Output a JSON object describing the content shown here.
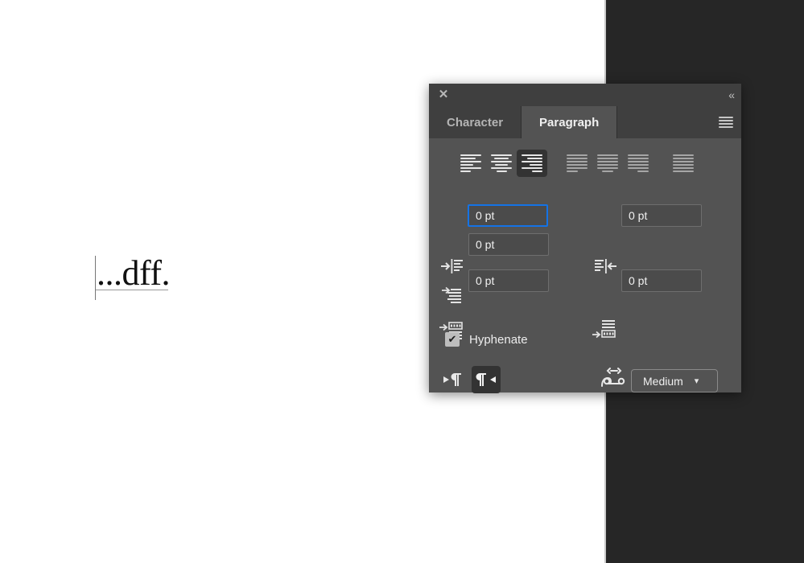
{
  "canvas": {
    "text_object": {
      "content": "...dff.",
      "caret_visible": true,
      "baseline_visible": true
    },
    "page_background": "#ffffff",
    "workspace_background": "#262626"
  },
  "panel": {
    "titlebar": {
      "close_label": "✕",
      "collapse_label": "«",
      "close_icon": "close-icon",
      "collapse_icon": "double-chevron-left-icon"
    },
    "tabs": [
      {
        "label": "Character",
        "active": false
      },
      {
        "label": "Paragraph",
        "active": true
      }
    ],
    "menu_icon": "hamburger-menu-icon",
    "alignment": {
      "group_label": "Paragraph alignment",
      "options": [
        {
          "name": "align-left",
          "label": "Align left",
          "selected": false,
          "enabled": true
        },
        {
          "name": "align-center",
          "label": "Align center",
          "selected": false,
          "enabled": true
        },
        {
          "name": "align-right",
          "label": "Align right",
          "selected": true,
          "enabled": true
        },
        {
          "name": "justify-last-left",
          "label": "Justify with last line aligned left",
          "selected": false,
          "enabled": false
        },
        {
          "name": "justify-last-center",
          "label": "Justify with last line aligned center",
          "selected": false,
          "enabled": false
        },
        {
          "name": "justify-last-right",
          "label": "Justify with last line aligned right",
          "selected": false,
          "enabled": false
        },
        {
          "name": "justify-all",
          "label": "Justify all lines",
          "selected": false,
          "enabled": false
        }
      ]
    },
    "fields": {
      "indent_left": {
        "icon": "indent-left-icon",
        "value": "0 pt",
        "focused": true
      },
      "indent_right": {
        "icon": "indent-right-icon",
        "value": "0 pt",
        "focused": false
      },
      "indent_first_line": {
        "icon": "indent-first-line-icon",
        "value": "0 pt",
        "focused": false
      },
      "space_before": {
        "icon": "space-before-paragraph-icon",
        "value": "0 pt",
        "focused": false
      },
      "space_after": {
        "icon": "space-after-paragraph-icon",
        "value": "0 pt",
        "focused": false
      }
    },
    "direction": {
      "options": [
        {
          "name": "paragraph-direction-ltr",
          "label": "Left to right paragraph direction",
          "selected": false
        },
        {
          "name": "paragraph-direction-rtl",
          "label": "Right to left paragraph direction",
          "selected": true
        }
      ]
    },
    "spacing": {
      "icon": "glyph-spacing-icon",
      "dropdown_value": "Medium",
      "caret_icon": "chevron-down-icon"
    },
    "hyphenate": {
      "label": "Hyphenate",
      "checked": true,
      "check_glyph": "✔"
    }
  },
  "colors": {
    "panel_background": "#535353",
    "panel_header": "#3f3f3f",
    "field_background": "#4b4b4b",
    "focus_accent": "#1473e6",
    "selected_button": "#333333",
    "text_primary": "#f0f0f0",
    "text_dim": "#b4b4b4",
    "icon_active": "#e6e6e6",
    "icon_disabled": "#a6a6a6"
  }
}
